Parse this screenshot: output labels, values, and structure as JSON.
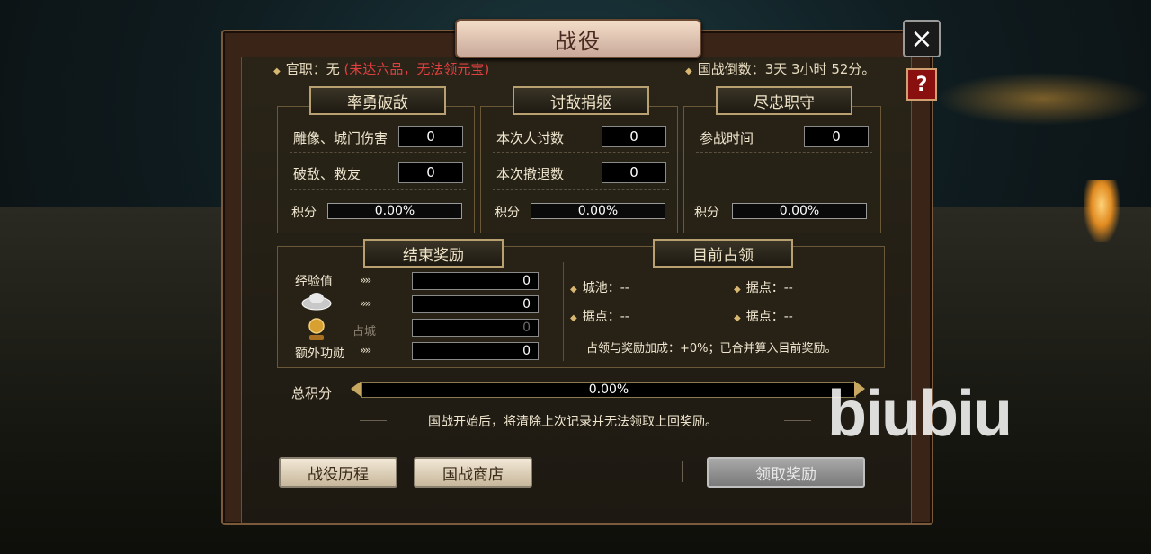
{
  "window": {
    "title": "战役",
    "close_icon": "×",
    "help_icon": "?"
  },
  "header": {
    "rank_label": "官职：无",
    "rank_warning": "(未达六品，无法领元宝)",
    "countdown": "国战倒数：3天 3小时 52分。"
  },
  "sections": {
    "bravery": {
      "title": "率勇破敌",
      "rows": [
        {
          "label": "雕像、城门伤害",
          "value": "0"
        },
        {
          "label": "破敌、救友",
          "value": "0"
        }
      ],
      "score_label": "积分",
      "score_value": "0.00%"
    },
    "sacrifice": {
      "title": "讨敌捐躯",
      "rows": [
        {
          "label": "本次人讨数",
          "value": "0"
        },
        {
          "label": "本次撤退数",
          "value": "0"
        }
      ],
      "score_label": "积分",
      "score_value": "0.00%"
    },
    "duty": {
      "title": "尽忠职守",
      "rows": [
        {
          "label": "参战时间",
          "value": "0"
        }
      ],
      "score_label": "积分",
      "score_value": "0.00%"
    }
  },
  "end_reward": {
    "title": "结束奖励",
    "arrows": "››››",
    "rows": [
      {
        "label": "经验值",
        "icon": "",
        "value": "0"
      },
      {
        "label": "",
        "icon": "silver-ingot-icon",
        "value": "0"
      },
      {
        "label": "占城",
        "icon": "gold-coin-icon",
        "value": "0"
      },
      {
        "label": "额外功勋",
        "icon": "",
        "value": "0"
      }
    ]
  },
  "occupation": {
    "title": "目前占领",
    "items": [
      {
        "label": "城池：--"
      },
      {
        "label": "据点：--"
      },
      {
        "label": "据点：--"
      },
      {
        "label": "据点：--"
      }
    ],
    "bonus_text": "占领与奖励加成：+0%；已合并算入目前奖励。"
  },
  "total": {
    "label": "总积分",
    "value": "0.00%"
  },
  "notice": "国战开始后，将清除上次记录并无法领取上回奖励。",
  "buttons": {
    "history": "战役历程",
    "shop": "国战商店",
    "claim": "领取奖励"
  },
  "watermark": "biubiu",
  "colors": {
    "warning": "#e04040",
    "panel": "#3a2418",
    "accent": "#d8b870"
  }
}
